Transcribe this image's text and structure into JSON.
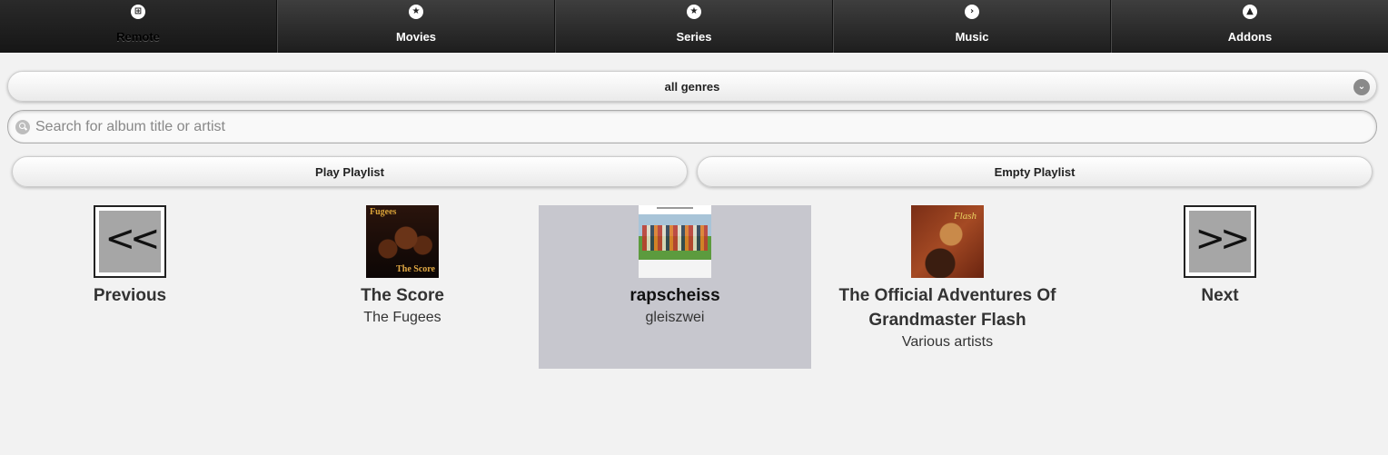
{
  "nav": {
    "tabs": [
      {
        "label": "Remote",
        "icon": "grid-icon",
        "glyph": "⊞"
      },
      {
        "label": "Movies",
        "icon": "star-icon",
        "glyph": "★"
      },
      {
        "label": "Series",
        "icon": "star-icon",
        "glyph": "★"
      },
      {
        "label": "Music",
        "icon": "chevron-right-icon",
        "glyph": "›"
      },
      {
        "label": "Addons",
        "icon": "alert-icon",
        "glyph": "▲"
      }
    ]
  },
  "controls": {
    "genre_select": {
      "value": "all genres",
      "arrow": "⌄"
    },
    "search": {
      "placeholder": "Search for album title or artist",
      "value": ""
    },
    "play_playlist_label": "Play Playlist",
    "empty_playlist_label": "Empty Playlist"
  },
  "albums": {
    "previous": {
      "glyph": "<<",
      "label": "Previous"
    },
    "next": {
      "glyph": ">>",
      "label": "Next"
    },
    "items": [
      {
        "title": "The Score",
        "artist": "The Fugees",
        "cover_text_top": "Fugees",
        "cover_text_bottom": "The Score"
      },
      {
        "title": "rapscheiss",
        "artist": "gleiszwei",
        "selected": true
      },
      {
        "title": "The Official Adventures Of Grandmaster Flash",
        "artist": "Various artists",
        "cover_text": "Flash"
      }
    ]
  },
  "colors": {
    "navbar_top": "#3e3e3e",
    "navbar_bottom": "#1e1e1e",
    "selected_album_bg": "#c7c7ce",
    "page_bg": "#f2f2f2"
  }
}
